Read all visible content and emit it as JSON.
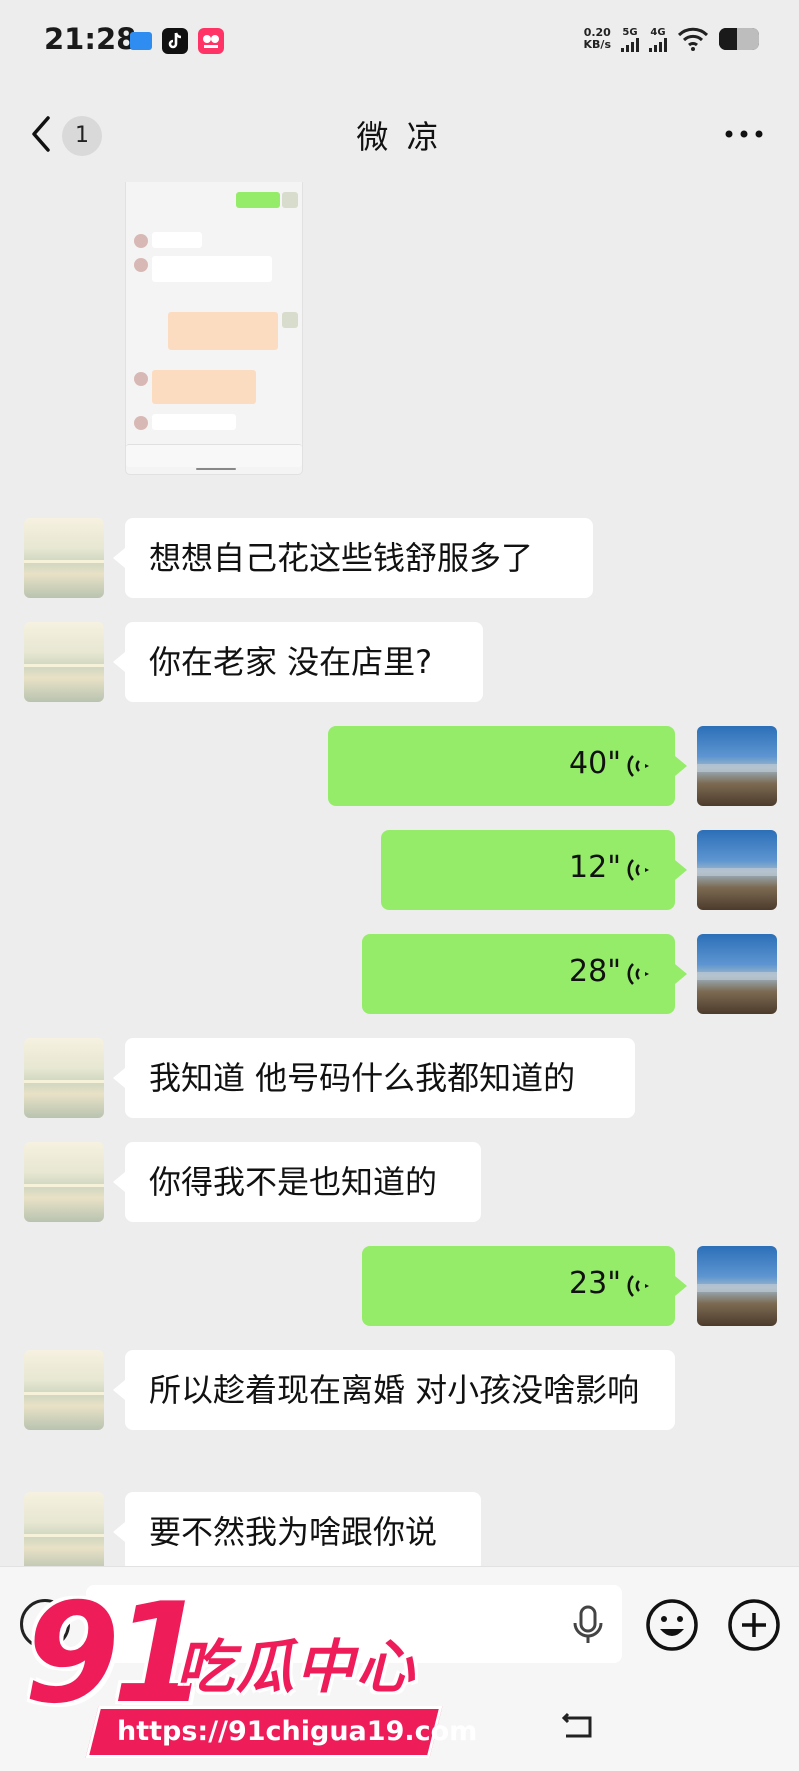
{
  "status_bar": {
    "time": "21:28",
    "net_speed_value": "0.20",
    "net_speed_unit": "KB/s",
    "net1": "5G",
    "net2": "4G",
    "battery_level": 0.45
  },
  "header": {
    "back_icon": "chevron-left-icon",
    "unread_badge": "1",
    "title": "微 凉",
    "more_icon": "more-horizontal-icon"
  },
  "messages": [
    {
      "side": "left",
      "type": "text",
      "text": "想想自己花这些钱舒服多了"
    },
    {
      "side": "left",
      "type": "text",
      "text": "你在老家  没在店里?"
    },
    {
      "side": "right",
      "type": "voice",
      "duration": "40\""
    },
    {
      "side": "right",
      "type": "voice",
      "duration": "12\""
    },
    {
      "side": "right",
      "type": "voice",
      "duration": "28\""
    },
    {
      "side": "left",
      "type": "text",
      "text": "我知道  他号码什么我都知道的"
    },
    {
      "side": "left",
      "type": "text",
      "text": "你得我不是也知道的"
    },
    {
      "side": "right",
      "type": "voice",
      "duration": "23\""
    },
    {
      "side": "left",
      "type": "text",
      "text": "所以趁着现在离婚  对小孩没啥影响"
    },
    {
      "side": "left",
      "type": "text",
      "text": "要不然我为啥跟你说"
    }
  ],
  "input_bar": {
    "value": "",
    "voice_toggle_icon": "voice-toggle-icon",
    "mic_icon": "microphone-icon",
    "emoji_icon": "emoji-icon",
    "plus_icon": "plus-circle-icon"
  },
  "watermark": {
    "logo_number": "91",
    "logo_text": "吃瓜中心",
    "url": "https://91chigua19.com"
  },
  "colors": {
    "background": "#ededed",
    "voice_bubble": "#95ec69",
    "text_bubble": "#ffffff",
    "watermark": "#ee1d5a"
  }
}
